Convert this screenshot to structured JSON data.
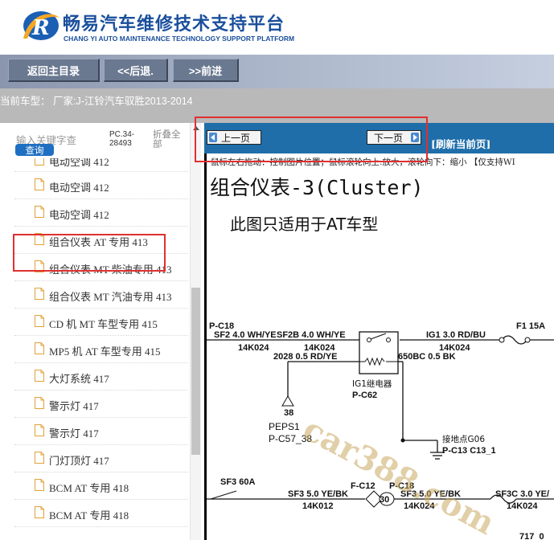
{
  "header": {
    "title": "畅易汽车维修技术支持平台",
    "subtitle": "CHANG YI AUTO MAINTENANCE TECHNOLOGY SUPPORT PLATFORM"
  },
  "toolbar": {
    "home_label": "返回主目录",
    "back_label": "<<后退.",
    "forward_label": ">>前进"
  },
  "current_car": "当前车型： 厂家:J-江铃汽车驭胜2013-2014",
  "sidebar": {
    "search_placeholder": "输入关键字查",
    "pc_code": "PC.34-28493",
    "collapse_label": "折叠全部",
    "query_label": "查询",
    "items": [
      {
        "label": "电动空调 412"
      },
      {
        "label": "电动空调 412"
      },
      {
        "label": "电动空调 412"
      },
      {
        "label": "组合仪表 AT 专用 413"
      },
      {
        "label": "组合仪表 MT 柴油专用 413"
      },
      {
        "label": "组合仪表 MT 汽油专用 413"
      },
      {
        "label": "CD 机 MT 车型专用 415"
      },
      {
        "label": "MP5 机 AT 车型专用 415"
      },
      {
        "label": "大灯系统 417"
      },
      {
        "label": "警示灯 417"
      },
      {
        "label": "警示灯 417"
      },
      {
        "label": "门灯顶灯 417"
      },
      {
        "label": "BCM AT 专用 418"
      },
      {
        "label": "BCM AT 专用 418"
      }
    ]
  },
  "content": {
    "prev_label": "上一页",
    "next_label": "下一页",
    "refresh_label": "[刷新当前页]",
    "hint": "鼠标左右拖动：控制图片位置；鼠标滚轮向上:放大，滚轮向下：缩小 【仅支持WI",
    "diagram_title": "组合仪表-3(Cluster)",
    "diagram_note": "此图只适用于AT车型"
  },
  "diagram": {
    "c18_top": "P-C18",
    "sf2_left": "SF2 4.0 WH/YE",
    "sf2b": "SF2B 4.0 WH/YE",
    "k14_1": "14K024",
    "k14_2": "14K024",
    "ig1": "IG1 3.0 RD/BU",
    "k14_3": "14K024",
    "f1": "F1 15A",
    "w2028": "2028 0.5  RD/YE",
    "w650": "650BC 0.5  BK",
    "relay_name": "IG1继电器",
    "relay_conn": "P-C62",
    "tri_num": "38",
    "peps_name": "PEPS1",
    "peps_conn": "P-C57_38",
    "ground_name": "接地点G06",
    "ground_conn": "P-C13 C13_1",
    "sf3_60": "SF3 60A",
    "fc12": "F-C12",
    "c18_bottom": "P-C18",
    "sf3_wire": "SF3 5.0 YE/BK",
    "sf3_wire2": "SF3 5.0 YE/BK",
    "sf3c": "SF3C 3.0 YE/",
    "k012": "14K012",
    "diamond_num": "30",
    "k024_b": "14K024",
    "k024_c": "14K024",
    "page_num": "717_0",
    "watermark": "car388.com"
  }
}
